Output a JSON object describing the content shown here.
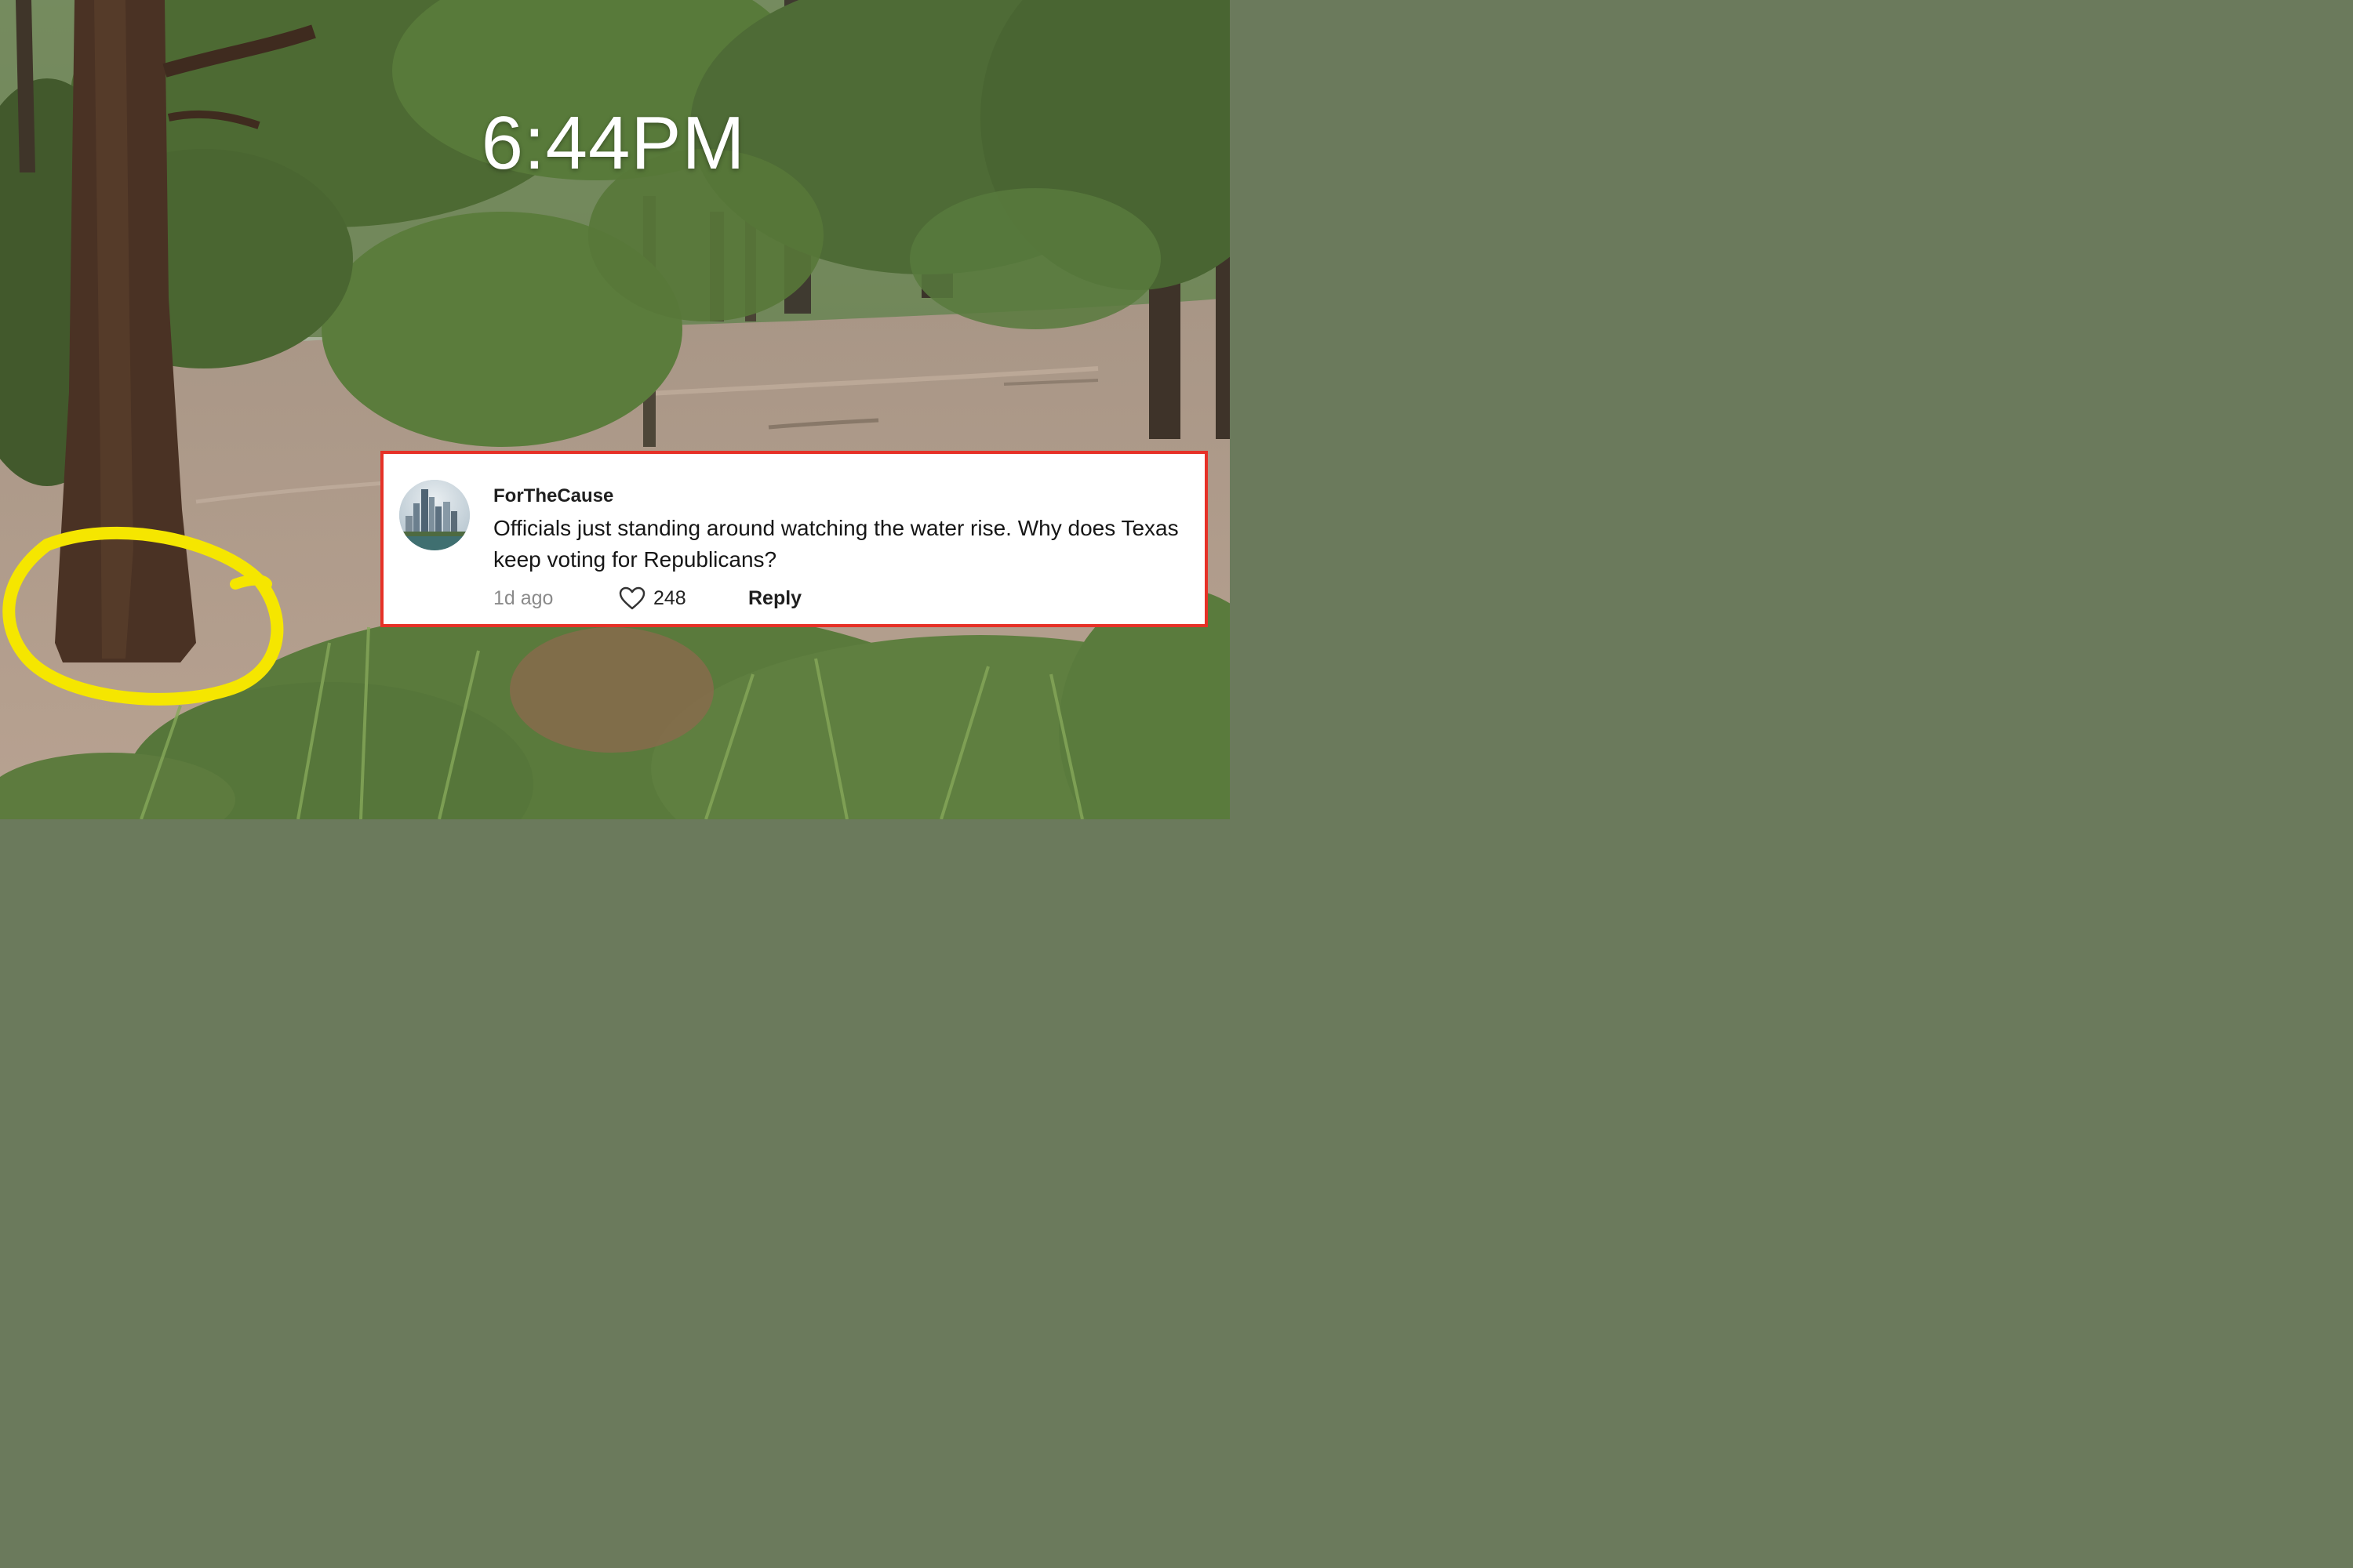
{
  "video": {
    "timestamp_overlay": "6:44PM"
  },
  "comment": {
    "username": "ForTheCause",
    "text": "Officials just standing around watching the water rise. Why does Texas keep voting for Republicans?",
    "age": "1d ago",
    "likes": "248",
    "reply_label": "Reply"
  },
  "colors": {
    "highlight_circle": "#f5e600",
    "comment_border": "#e63127"
  },
  "icons": {
    "like": "heart-outline-icon"
  }
}
